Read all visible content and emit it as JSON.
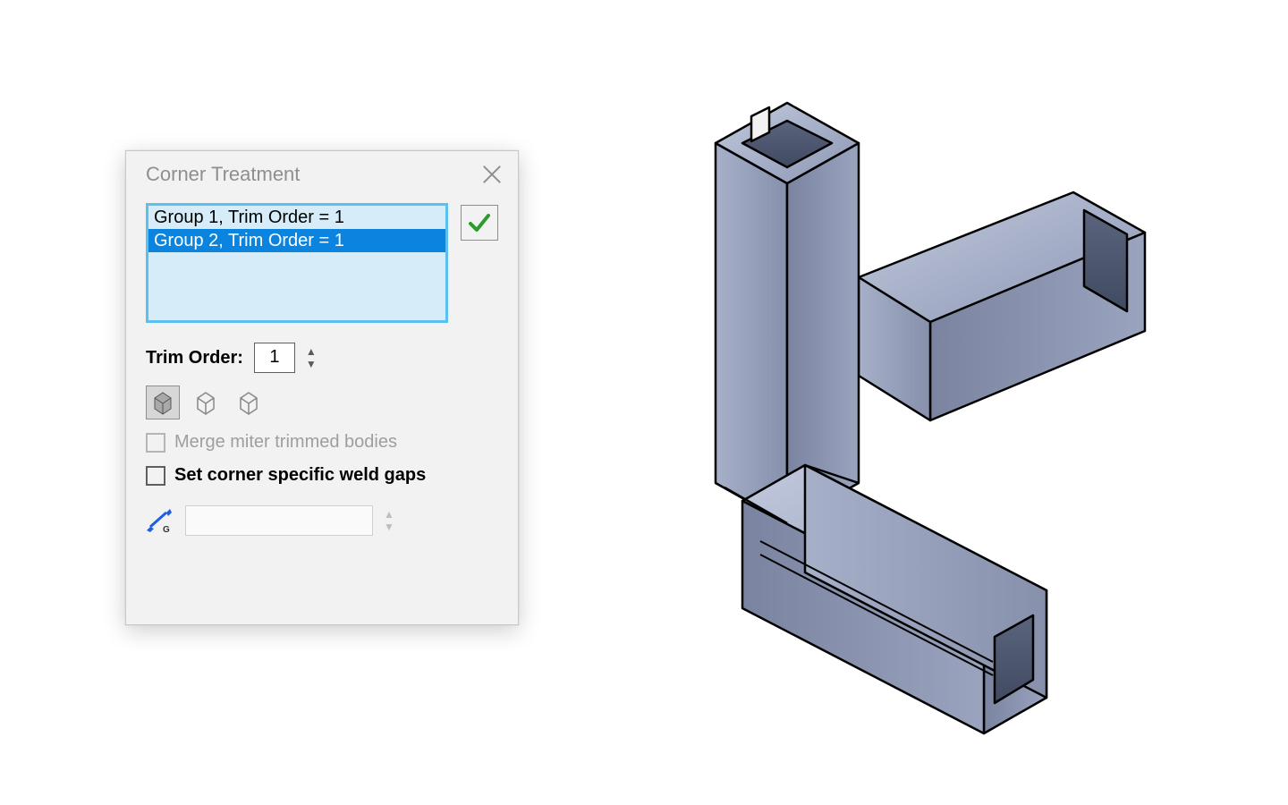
{
  "dialog": {
    "title": "Corner Treatment",
    "groups": [
      {
        "label": "Group 1, Trim Order = 1",
        "selected": false
      },
      {
        "label": "Group 2, Trim Order = 1",
        "selected": true
      }
    ],
    "trim_order": {
      "label": "Trim Order:",
      "value": "1"
    },
    "corner_type_icons": [
      {
        "name": "corner-type-miter",
        "active": true
      },
      {
        "name": "corner-type-butt1",
        "active": false
      },
      {
        "name": "corner-type-butt2",
        "active": false
      }
    ],
    "merge_miter": {
      "label": "Merge miter trimmed bodies",
      "checked": false,
      "enabled": false
    },
    "set_weld_gaps": {
      "label": "Set corner specific weld gaps",
      "checked": false,
      "enabled": true
    },
    "weld_gap_value": ""
  },
  "colors": {
    "selection": "#0b84e0",
    "list_bg": "#d6ecf8",
    "list_border": "#5bc0ee",
    "ok_check": "#2e9a2e",
    "steel_face": "#9aa4bf",
    "steel_light": "#b9c1d6",
    "steel_dark": "#6d7792"
  }
}
